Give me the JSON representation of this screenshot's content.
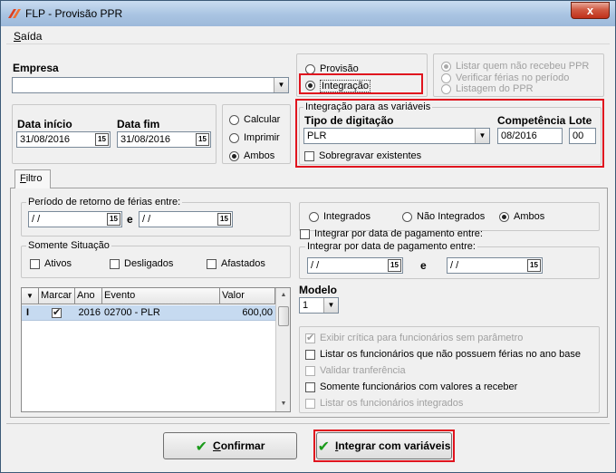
{
  "window": {
    "title": "FLP - Provisão PPR",
    "close_label": "x"
  },
  "menu": {
    "saida_first": "S",
    "saida_rest": "aída"
  },
  "empresa": {
    "label": "Empresa",
    "value": ""
  },
  "modo": {
    "provisao": "Provisão",
    "integracao": "Integração"
  },
  "listar": {
    "quem_nao_recebeu": "Listar quem não recebeu PPR",
    "verificar_ferias": "Verificar férias no período",
    "listagem": "Listagem do PPR"
  },
  "datas": {
    "inicio_label": "Data início",
    "inicio_value": "31/08/2016",
    "fim_label": "Data fim",
    "fim_value": "31/08/2016",
    "date_btn": "15"
  },
  "acao": {
    "calcular": "Calcular",
    "imprimir": "Imprimir",
    "ambos": "Ambos"
  },
  "integracao_variaveis": {
    "legend": "Integração para as variáveis",
    "tipo_label": "Tipo de digitação",
    "tipo_value": "PLR",
    "competencia_label": "Competência",
    "competencia_value": "08/2016",
    "lote_label": "Lote",
    "lote_value": "00",
    "sobregravar": "Sobregravar existentes"
  },
  "tab": {
    "filtro_first": "F",
    "filtro_rest": "iltro"
  },
  "periodo_ferias": {
    "legend": "Período de retorno de férias entre:",
    "de_value": "/ /",
    "e_label": "e",
    "ate_value": "/ /"
  },
  "situacao": {
    "legend": "Somente Situação",
    "ativos": "Ativos",
    "desligados": "Desligados",
    "afastados": "Afastados"
  },
  "integrados": {
    "integrados": "Integrados",
    "nao_integrados": "Não Integrados",
    "ambos": "Ambos"
  },
  "integrar_data": {
    "checkbox": "Integrar por data de pagamento entre:",
    "legend": "Integrar por data de pagamento entre:",
    "de_value": "/ /",
    "e_label": "e",
    "ate_value": "/ /"
  },
  "grid": {
    "headers": {
      "marcar": "Marcar",
      "ano": "Ano",
      "evento": "Evento",
      "valor": "Valor"
    },
    "rows": [
      {
        "cursor": "I",
        "ano": "2016",
        "evento": "02700 - PLR",
        "valor": "600,00"
      }
    ]
  },
  "modelo": {
    "label": "Modelo",
    "value": "1"
  },
  "opcoes": {
    "exibir_critica": "Exibir crítica para funcionários sem parâmetro",
    "listar_sem_ferias": "Listar os funcionários que não possuem férias no ano base",
    "validar_transferencia": "Validar tranferência",
    "somente_valores": "Somente funcionários com valores a receber",
    "listar_integrados": "Listar os funcionários integrados"
  },
  "buttons": {
    "confirmar_first": "C",
    "confirmar_rest": "onfirmar",
    "integrar_first": "I",
    "integrar_rest": "ntegrar com variáveis"
  },
  "colors": {
    "highlight_red": "#e0141e",
    "selected_row": "#c6daf0",
    "confirm_green": "#1a9a1a"
  }
}
